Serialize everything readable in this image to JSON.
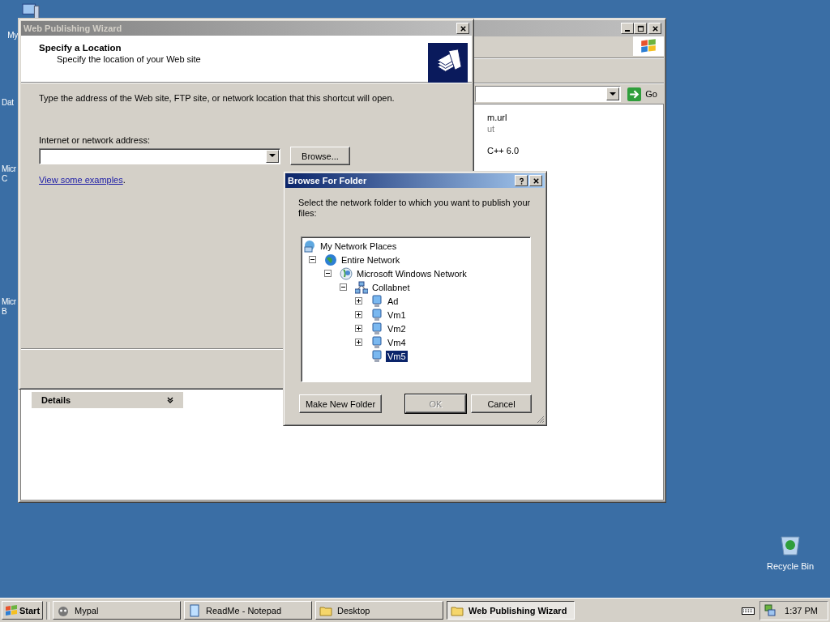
{
  "desktop_icons": [
    {
      "lines": [
        "My"
      ]
    },
    {
      "lines": [
        "Dat"
      ]
    },
    {
      "lines": [
        "Micr",
        "C"
      ]
    },
    {
      "lines": [
        "Micr",
        "B"
      ]
    }
  ],
  "recycle_bin": {
    "label": "Recycle Bin"
  },
  "explorer": {
    "go_button": "Go",
    "files": [
      {
        "name": "m.url",
        "detail": "ut"
      },
      {
        "name": "C++ 6.0"
      }
    ],
    "details": {
      "title": "Details"
    }
  },
  "wizard": {
    "title": "Web Publishing Wizard",
    "active": false,
    "heading": "Specify a Location",
    "subheading": "Specify the location of your Web site",
    "instruction": "Type the address of the Web site, FTP site, or network location that this shortcut will open.",
    "address_label": "Internet or network address:",
    "browse_button": "Browse...",
    "link": "View some examples",
    "link_tail": "."
  },
  "browse_dialog": {
    "title": "Browse For Folder",
    "active": true,
    "prompt": "Select the network folder to which you want to publish your files:",
    "tree": [
      {
        "label": "My Network Places",
        "kind": "places",
        "selected": false,
        "children": [
          {
            "label": "Entire Network",
            "kind": "globe",
            "expanded": true,
            "selected": false,
            "children": [
              {
                "label": "Microsoft Windows Network",
                "kind": "network",
                "expanded": true,
                "selected": false,
                "children": [
                  {
                    "label": "Collabnet",
                    "kind": "workgroup",
                    "expanded": true,
                    "selected": false,
                    "children": [
                      {
                        "label": "Ad",
                        "kind": "computer",
                        "expanded": false,
                        "selected": false
                      },
                      {
                        "label": "Vm1",
                        "kind": "computer",
                        "expanded": false,
                        "selected": false
                      },
                      {
                        "label": "Vm2",
                        "kind": "computer",
                        "expanded": false,
                        "selected": false
                      },
                      {
                        "label": "Vm4",
                        "kind": "computer",
                        "expanded": false,
                        "selected": false
                      },
                      {
                        "label": "Vm5",
                        "kind": "computer",
                        "selected": true
                      }
                    ]
                  }
                ]
              }
            ]
          }
        ]
      }
    ],
    "buttons": [
      {
        "label": "Make New Folder",
        "disabled": false
      },
      {
        "label": "OK",
        "disabled": true
      },
      {
        "label": "Cancel",
        "disabled": false
      }
    ]
  },
  "taskbar": {
    "start": "Start",
    "tasks": [
      {
        "label": "Mypal",
        "kind": "browser",
        "selected": false
      },
      {
        "label": "ReadMe - Notepad",
        "kind": "notepad",
        "selected": false
      },
      {
        "label": "Desktop",
        "kind": "folder",
        "selected": false
      },
      {
        "label": "Web Publishing Wizard",
        "kind": "folder",
        "selected": true
      }
    ],
    "clock": "1:37 PM"
  }
}
